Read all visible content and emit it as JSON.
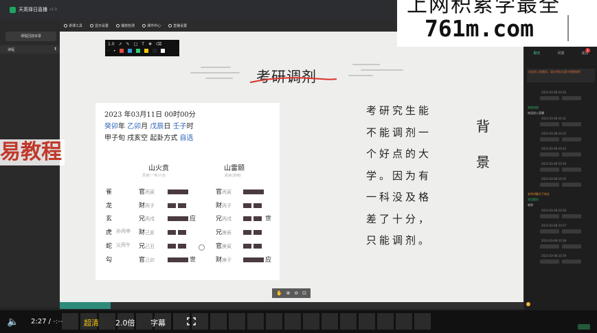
{
  "app": {
    "title": "天英择日直播",
    "version": "v1.0"
  },
  "left_panel": {
    "header": "课程回放目录",
    "item": "课程",
    "pin_icon": "pin-icon"
  },
  "toolbar": {
    "items": [
      "讲课工具",
      "显示设置",
      "播放检测",
      "课件中心",
      "直播设置"
    ]
  },
  "pen_toolbar": {
    "width_label": "1.0"
  },
  "slide": {
    "title": "考研调剂",
    "card": {
      "datetime": "2023 年03月11日 00时00分",
      "pillars": [
        {
          "text": "癸卯",
          "unit": "年"
        },
        {
          "text": "乙卯",
          "unit": "月"
        },
        {
          "text": "戊辰",
          "unit": "日"
        },
        {
          "text": "壬子",
          "unit": "时"
        }
      ],
      "xun": "甲子旬 戌亥空 起卦方式 ",
      "method": "自选",
      "hex_left": {
        "name": "山火贲",
        "sub": "艮宫(一世)六合"
      },
      "hex_right": {
        "name": "山雷颐",
        "sub": "巽宫(游魂)"
      },
      "rows": [
        {
          "god": "雀",
          "fu": "",
          "l_rel": "官",
          "l_gz": "丙寅",
          "l_mark": "",
          "r_rel": "官",
          "r_gz": "丙寅",
          "r_mark": ""
        },
        {
          "god": "龙",
          "fu": "",
          "l_rel": "财",
          "l_gz": "丙子",
          "l_mark": "",
          "r_rel": "财",
          "r_gz": "丙子",
          "r_mark": ""
        },
        {
          "god": "玄",
          "fu": "",
          "l_rel": "兄",
          "l_gz": "丙戌",
          "l_mark": "应",
          "r_rel": "兄",
          "r_gz": "丙戌",
          "r_mark": "世"
        },
        {
          "god": "虎",
          "fu": "孙丙申",
          "l_rel": "财",
          "l_gz": "己亥",
          "l_mark": "",
          "r_rel": "兄",
          "r_gz": "庚辰",
          "r_mark": ""
        },
        {
          "god": "蛇",
          "fu": "父丙午",
          "l_rel": "兄",
          "l_gz": "己丑",
          "l_mark": "",
          "r_rel": "官",
          "r_gz": "庚寅",
          "r_mark": ""
        },
        {
          "god": "勾",
          "fu": "",
          "l_rel": "官",
          "l_gz": "己卯",
          "l_mark": "世",
          "r_rel": "财",
          "r_gz": "庚子",
          "r_mark": "应"
        }
      ]
    },
    "body_lines": [
      "考研究生能",
      "不能调剂一",
      "个好点的大",
      "学。因为有",
      "一科没及格",
      "差了十分，",
      "只能调剂。"
    ],
    "side_labels": [
      "背",
      "景"
    ]
  },
  "chat": {
    "tabs": [
      "聊天",
      "问答",
      "成员"
    ],
    "badge": "1",
    "notice": "欢迎进入直播间，请文明发言遵守直播规则",
    "messages": [
      {
        "type": "time",
        "text": "2023-03-08 20:30"
      },
      {
        "type": "green",
        "text": "系统消息"
      },
      {
        "type": "white",
        "text": "欢迎进入直播"
      },
      {
        "type": "time",
        "text": "2023-03-08 20:31"
      },
      {
        "type": "time",
        "text": "2023-03-08 20:32"
      },
      {
        "type": "time",
        "text": "2023-03-08 20:33"
      },
      {
        "type": "time",
        "text": "2023-03-08 20:34"
      },
      {
        "type": "time",
        "text": "2023-03-08 20:35"
      },
      {
        "type": "orange",
        "text": "老师讲解天干地支"
      },
      {
        "type": "green",
        "text": "学员提问"
      },
      {
        "type": "white",
        "text": "收到"
      },
      {
        "type": "time",
        "text": "2023-03-08 20:36"
      },
      {
        "type": "time",
        "text": "2023-03-08 20:37"
      },
      {
        "type": "time",
        "text": "2023-03-08 20:38"
      },
      {
        "type": "time",
        "text": "2023-03-08 20:39"
      }
    ]
  },
  "player": {
    "current": "2:27",
    "separator": " / ",
    "duration": "-:--",
    "quality": "超清",
    "speed": "2.0倍",
    "subtitle": "字幕",
    "progress": 0.11
  },
  "watermark": {
    "top_text": "上网积累学最全",
    "url": "761m.com",
    "left_text": "易教程"
  },
  "colors": {
    "accent": "#2a63b8",
    "quality": "#f1c40f",
    "bar": "#4a3b3e",
    "watermark_red": "#c0392b",
    "title_stroke": "#d9322a"
  }
}
